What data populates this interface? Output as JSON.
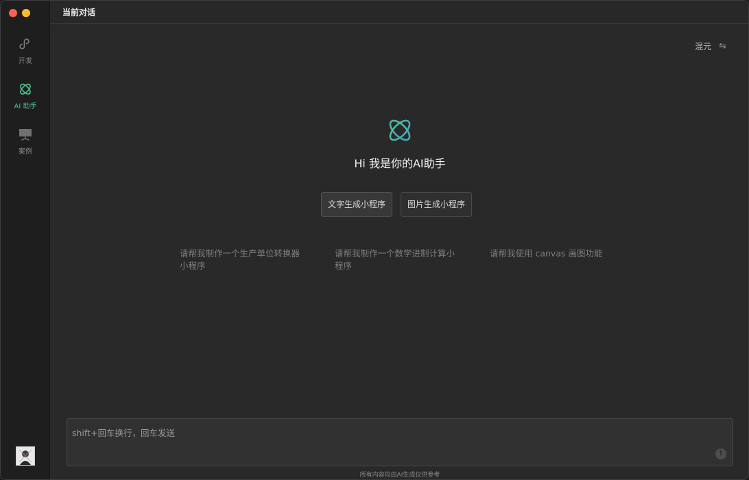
{
  "sidebar": {
    "items": [
      {
        "label": "开发",
        "icon": "mini-program-icon",
        "active": false
      },
      {
        "label": "AI 助手",
        "icon": "ai-assistant-icon",
        "active": true
      },
      {
        "label": "案例",
        "icon": "showcase-icon",
        "active": false
      }
    ]
  },
  "header": {
    "title": "当前对话"
  },
  "model": {
    "name": "混元",
    "switch_icon": "⇋"
  },
  "hero": {
    "greeting": "Hi 我是你的AI助手",
    "icon": "ai-assistant-icon"
  },
  "modes": [
    {
      "label": "文字生成小程序",
      "active": true
    },
    {
      "label": "图片生成小程序",
      "active": false
    }
  ],
  "suggestions": [
    "请帮我制作一个生产单位转换器小程序",
    "请帮我制作一个数学进制计算小程序",
    "请帮我使用 canvas 画图功能"
  ],
  "input": {
    "placeholder": "shift+回车换行，回车发送",
    "value": ""
  },
  "footer": {
    "disclaimer": "所有内容均由AI生成仅供参考"
  },
  "colors": {
    "accent": "#4fc08d",
    "accent_secondary": "#46a6c9",
    "background": "#292929",
    "sidebar": "#1e1e1e"
  }
}
